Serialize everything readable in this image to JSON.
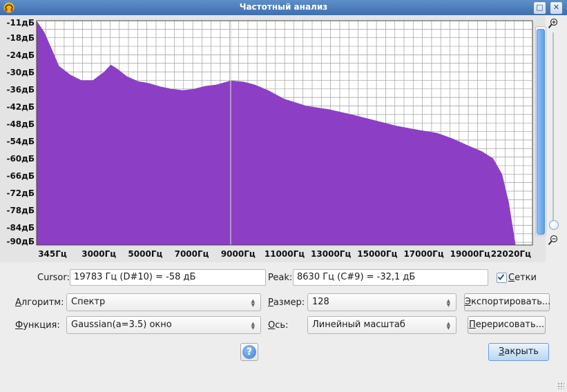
{
  "window": {
    "title": "Частотный анализ",
    "buttons": [
      "□",
      "✕"
    ]
  },
  "colors": {
    "spectrum_fill": "#8c3fc4",
    "grid": "#9e9e9e",
    "plot_bg": "#ffffff",
    "titlebar": "#4a7cba"
  },
  "chart_data": {
    "type": "area",
    "ylabel_unit": "дБ",
    "y_ticks": [
      "-11дБ",
      "-18дБ",
      "-24дБ",
      "-30дБ",
      "-36дБ",
      "-42дБ",
      "-48дБ",
      "-54дБ",
      "-60дБ",
      "-66дБ",
      "-72дБ",
      "-78дБ",
      "-84дБ",
      "-90дБ"
    ],
    "x_ticks": [
      "345Гц",
      "3000Гц",
      "5000Гц",
      "7000Гц",
      "9000Гц",
      "11000Гц",
      "13000Гц",
      "15000Гц",
      "17000Гц",
      "19000Гц",
      "22020Гц"
    ],
    "ylim": [
      -90,
      -11
    ],
    "xlim": [
      0,
      22050
    ],
    "x_scale": "linear",
    "grid": true,
    "cursor_marker_hz": 8630,
    "x": [
      0,
      345,
      1000,
      1500,
      2000,
      2500,
      3000,
      3300,
      3600,
      4000,
      4500,
      5000,
      5500,
      6000,
      6500,
      7000,
      7500,
      8000,
      8630,
      9200,
      9700,
      10300,
      11000,
      12000,
      13000,
      14000,
      15000,
      16000,
      17000,
      17800,
      18500,
      19200,
      19800,
      20300,
      20700,
      21000,
      21300,
      21700,
      22020
    ],
    "values": [
      -11,
      -15,
      -27,
      -30,
      -32,
      -32,
      -29,
      -26.5,
      -28,
      -30.5,
      -32.3,
      -33,
      -34.2,
      -35,
      -35.5,
      -35,
      -34,
      -33.5,
      -32.1,
      -32.5,
      -33.5,
      -35.5,
      -38.5,
      -41,
      -42.2,
      -44,
      -46,
      -48,
      -49.5,
      -50.5,
      -52.5,
      -55,
      -57,
      -59.5,
      -65,
      -75,
      -90,
      -90,
      -90
    ]
  },
  "cursor": {
    "label": "Cursor:",
    "value": "19783 Гц (D#10) = -58 дБ"
  },
  "peak": {
    "label": "Peak:",
    "value": "8630 Гц (C#9) = -32,1 дБ"
  },
  "grids": {
    "label": "Сетки",
    "checked": true
  },
  "algorithm": {
    "label": "Алгоритм:",
    "value": "Спектр"
  },
  "size": {
    "label": "Размер:",
    "value": "128"
  },
  "function": {
    "label": "Функция:",
    "value": "Gaussian(a=3.5) окно"
  },
  "axis": {
    "label": "Ось:",
    "value": "Линейный масштаб"
  },
  "buttons": {
    "export": "Экспортировать...",
    "redraw": "Перерисовать...",
    "close": "Закрыть",
    "help": "?"
  }
}
